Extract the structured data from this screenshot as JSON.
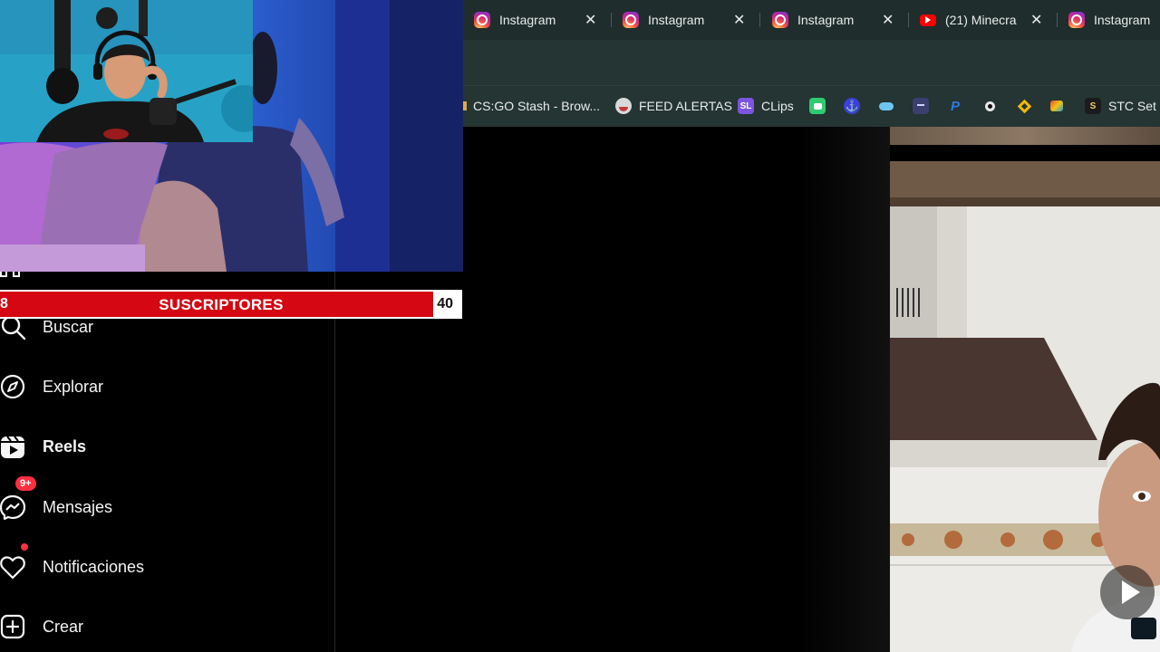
{
  "browser": {
    "tabs": [
      {
        "title": "Instagram",
        "favicon": "instagram-icon"
      },
      {
        "title": "Instagram",
        "favicon": "instagram-icon"
      },
      {
        "title": "Instagram",
        "favicon": "instagram-icon"
      },
      {
        "title": "(21) Minecra",
        "favicon": "youtube-icon"
      },
      {
        "title": "Instagram",
        "favicon": "instagram-icon"
      }
    ],
    "close_glyph": "✕",
    "bookmarks": [
      {
        "label": "CS:GO Stash - Brow...",
        "icon": "csgo-stash-icon"
      },
      {
        "label": "FEED ALERTAS",
        "icon": "feed-alertas-icon"
      },
      {
        "label": "CLips",
        "icon": "sl-clips-icon",
        "icon_text": "SL"
      },
      {
        "label": "",
        "icon": "bookmark-green-icon"
      },
      {
        "label": "",
        "icon": "bookmark-anchor-icon"
      },
      {
        "label": "",
        "icon": "bookmark-cloud-icon"
      },
      {
        "label": "",
        "icon": "bookmark-bot-icon"
      },
      {
        "label": "",
        "icon": "paypal-icon"
      },
      {
        "label": "",
        "icon": "bookmark-circle-icon"
      },
      {
        "label": "",
        "icon": "binance-icon"
      },
      {
        "label": "",
        "icon": "bookmark-colors-icon"
      },
      {
        "label": "STC Set P",
        "icon": "stc-icon",
        "icon_text": "S"
      }
    ]
  },
  "overlay": {
    "subscribers_label": "SUSCRIPTORES",
    "count_left": "8",
    "count_right": "40"
  },
  "sidebar": {
    "items": [
      {
        "label": "Buscar",
        "icon": "search-icon"
      },
      {
        "label": "Explorar",
        "icon": "compass-icon"
      },
      {
        "label": "Reels",
        "icon": "reels-icon",
        "active": true
      },
      {
        "label": "Mensajes",
        "icon": "messenger-icon",
        "badge": "9+"
      },
      {
        "label": "Notificaciones",
        "icon": "heart-icon",
        "dot": true
      },
      {
        "label": "Crear",
        "icon": "plus-square-icon"
      }
    ]
  },
  "reel": {
    "play_icon": "play-icon"
  },
  "colors": {
    "tab_bg": "#1f2e2c",
    "toolbar_bg": "#243533",
    "sub_bar_red": "#d40712",
    "badge_red": "#ff3040"
  }
}
